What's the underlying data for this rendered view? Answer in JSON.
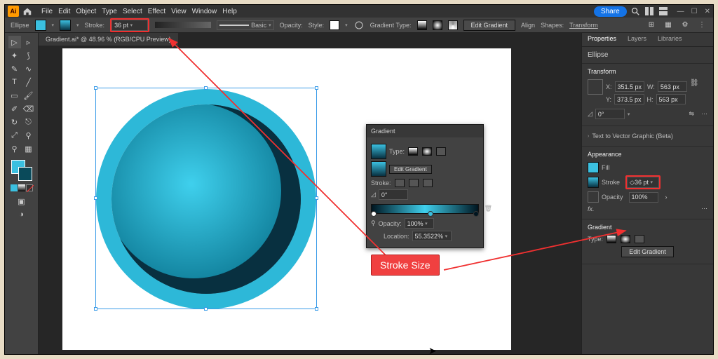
{
  "app": {
    "name": "Ai"
  },
  "menus": [
    "File",
    "Edit",
    "Object",
    "Type",
    "Select",
    "Effect",
    "View",
    "Window",
    "Help"
  ],
  "topbar": {
    "share_label": "Share",
    "wincontrols": [
      "—",
      "☐",
      "✕"
    ]
  },
  "control_bar": {
    "shape_label": "Ellipse",
    "stroke_label": "Stroke:",
    "stroke_value": "36 pt",
    "style_label": "Basic",
    "opacity_label": "Opacity:",
    "style_word": "Style:",
    "gradient_type_label": "Gradient Type:",
    "edit_gradient_label": "Edit Gradient",
    "align_label": "Align",
    "shapes_label": "Shapes:",
    "transform_label": "Transform"
  },
  "document": {
    "tab_title": "Gradient.ai* @ 48.96 % (RGB/CPU Preview)"
  },
  "properties": {
    "tabs": [
      "Properties",
      "Layers",
      "Libraries"
    ],
    "ellipse_label": "Ellipse",
    "transform": {
      "title": "Transform",
      "x_label": "X:",
      "x_value": "351.5 px",
      "y_label": "Y:",
      "y_value": "373.5 px",
      "w_label": "W:",
      "w_value": "563 px",
      "h_label": "H:",
      "h_value": "563 px",
      "rotate": "0°"
    },
    "text_to_vector": "Text to Vector Graphic (Beta)",
    "appearance": {
      "title": "Appearance",
      "fill_label": "Fill",
      "stroke_label": "Stroke",
      "stroke_value": "36 pt",
      "opacity_label": "Opacity",
      "opacity_value": "100%",
      "fx_label": "fx."
    },
    "gradient": {
      "title": "Gradient",
      "type_label": "Type:",
      "edit_label": "Edit Gradient"
    }
  },
  "gradient_panel": {
    "title": "Gradient",
    "type_label": "Type:",
    "edit_label": "Edit Gradient",
    "stroke_label": "Stroke:",
    "rotate": "0°",
    "opacity_label": "Opacity:",
    "opacity_value": "100%",
    "location_label": "Location:",
    "location_value": "55.3522%"
  },
  "annotation": {
    "label": "Stroke Size"
  },
  "colors": {
    "accent": "#3bc0e0",
    "annotation_red": "#f03030"
  }
}
